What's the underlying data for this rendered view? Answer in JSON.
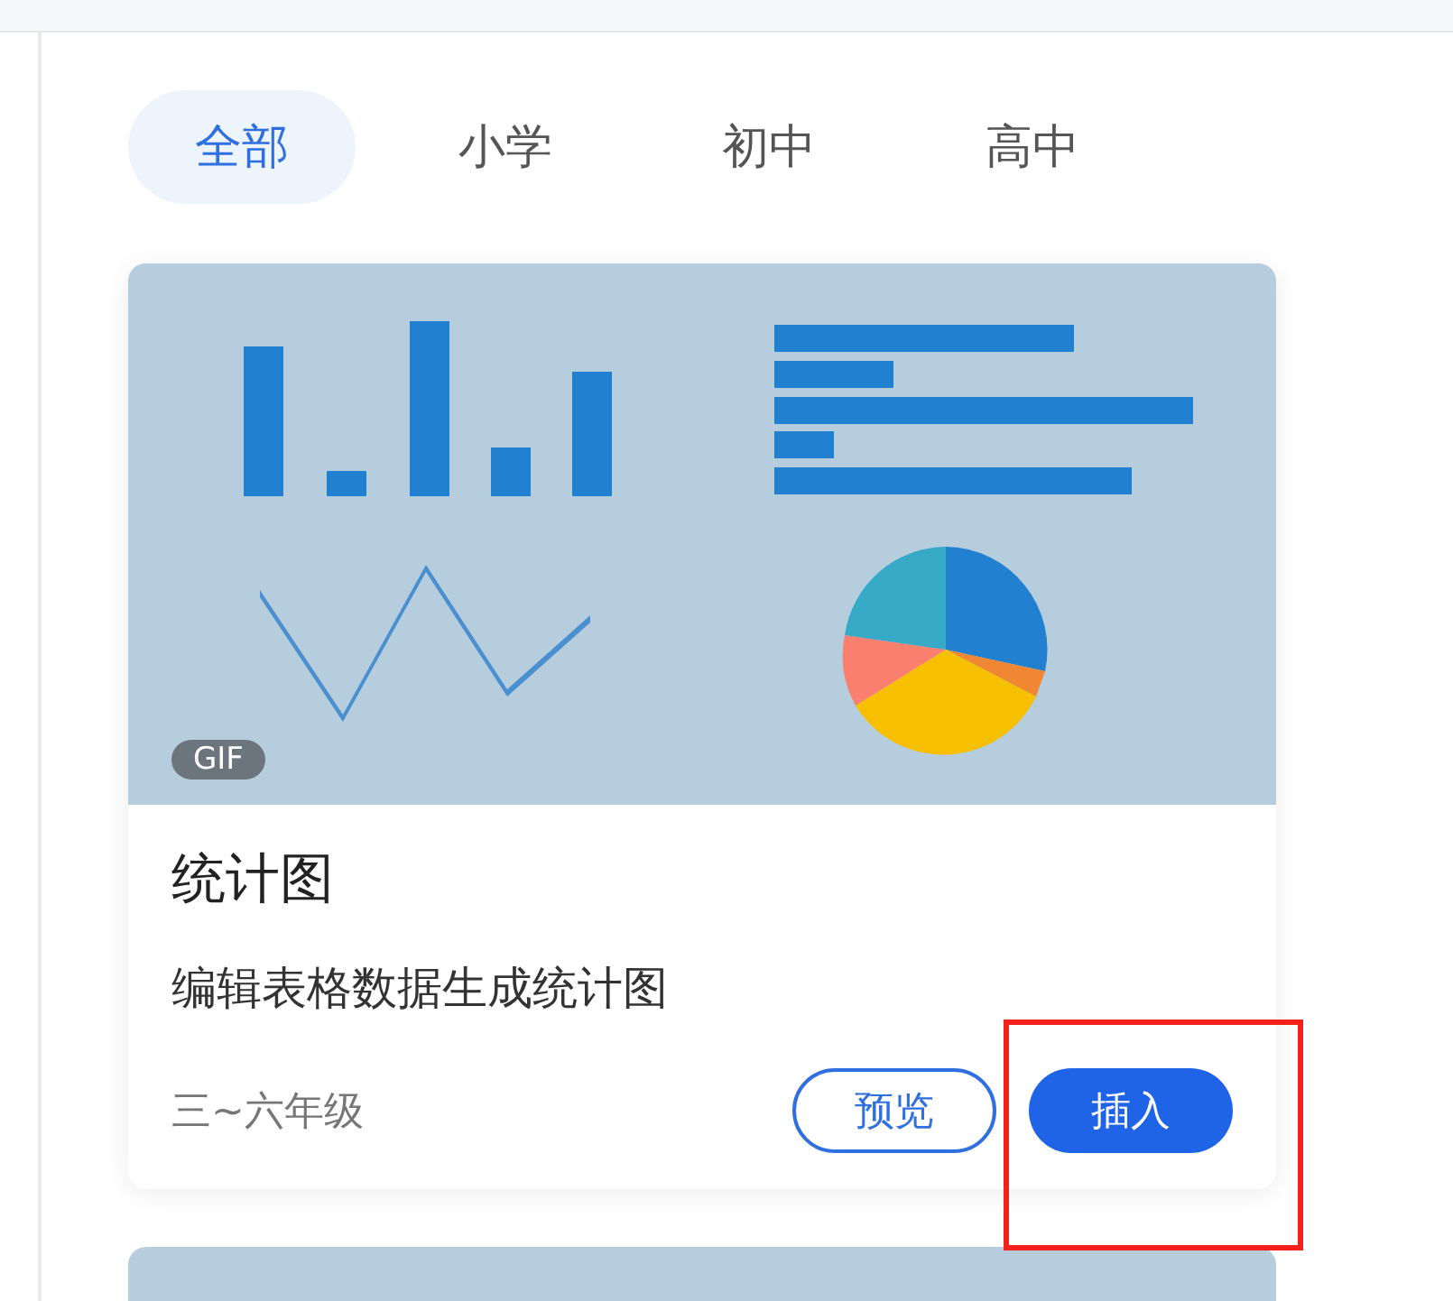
{
  "tabs": [
    {
      "label": "全部",
      "selected": true
    },
    {
      "label": "小学",
      "selected": false
    },
    {
      "label": "初中",
      "selected": false
    },
    {
      "label": "高中",
      "selected": false
    }
  ],
  "cards": [
    {
      "preview": {
        "kind": "picture",
        "badge": "GIF"
      },
      "title": "统计图",
      "description": "编辑表格数据生成统计图",
      "grade": "三~六年级",
      "buttons": [
        {
          "label": "预览",
          "kind": "outline"
        },
        {
          "label": "插入",
          "kind": "primary"
        }
      ]
    }
  ]
}
